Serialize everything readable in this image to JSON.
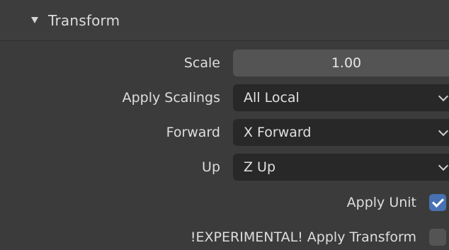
{
  "panel": {
    "title": "Transform",
    "collapsed": false
  },
  "scale": {
    "label": "Scale",
    "value": "1.00"
  },
  "apply_scalings": {
    "label": "Apply Scalings",
    "value": "All Local"
  },
  "forward": {
    "label": "Forward",
    "value": "X Forward"
  },
  "up": {
    "label": "Up",
    "value": "Z Up"
  },
  "apply_unit": {
    "label": "Apply Unit",
    "checked": true
  },
  "apply_transform": {
    "label": "!EXPERIMENTAL! Apply Transform",
    "checked": false
  },
  "icons": {
    "collapse": "triangle-down-icon",
    "dropdown": "chevron-down-icon",
    "check": "checkmark-icon"
  },
  "colors": {
    "checkbox_on": "#4772b3",
    "checkbox_off": "#545454",
    "number_field": "#545454",
    "dropdown_field": "#282828"
  }
}
